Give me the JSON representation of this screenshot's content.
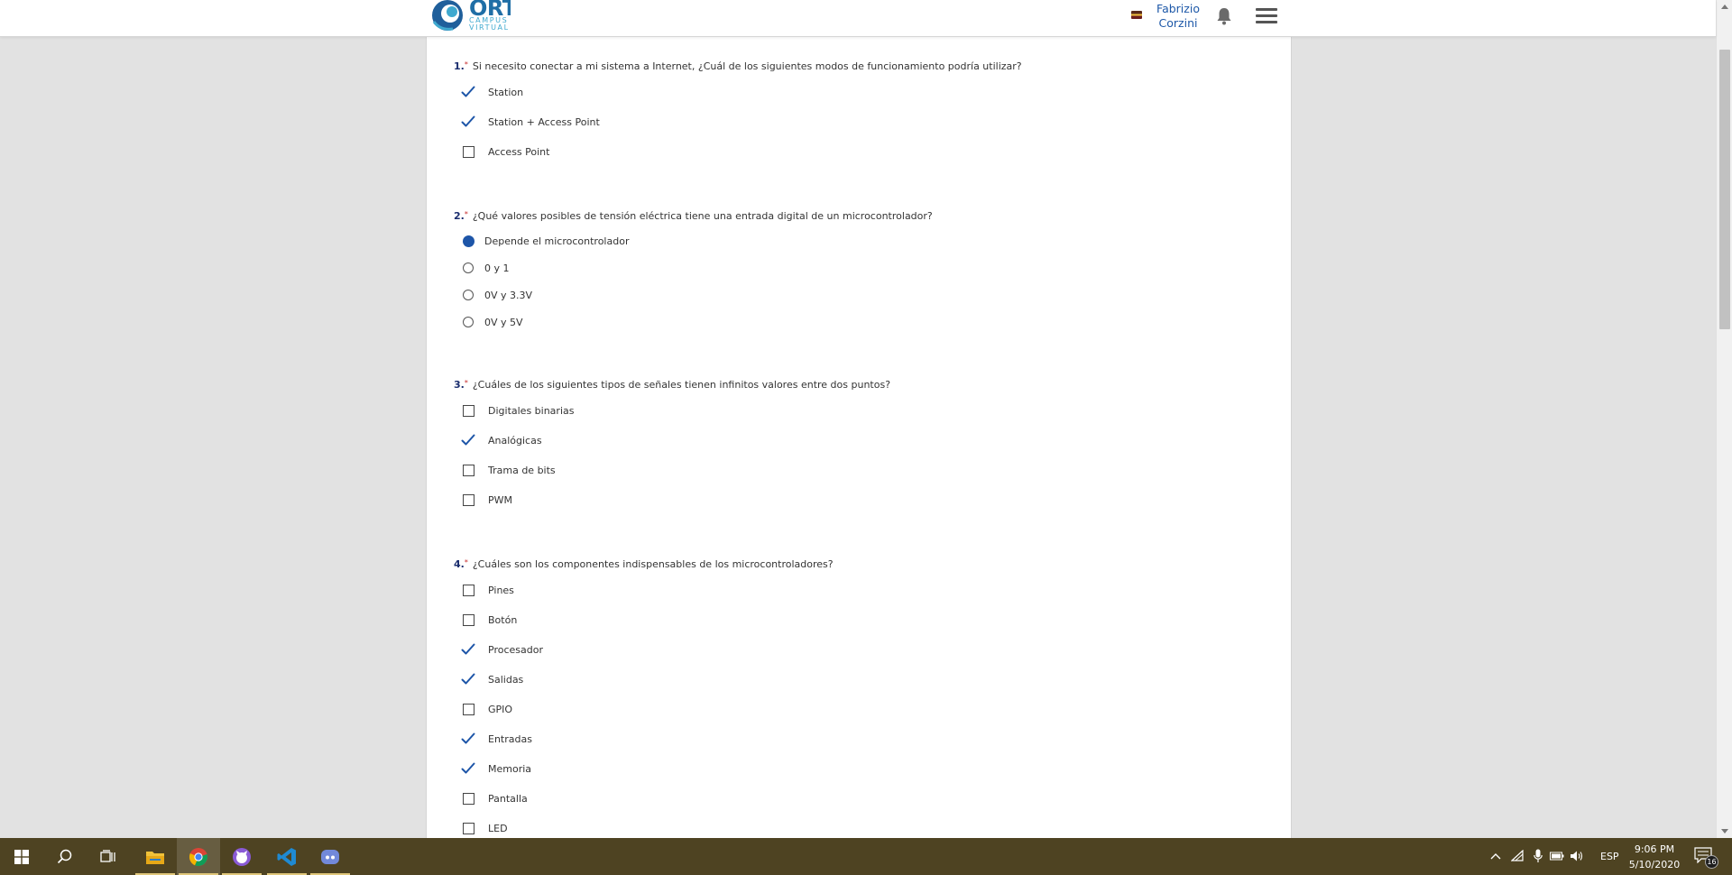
{
  "header": {
    "logo_text": "ORT",
    "logo_sub1": "CAMPUS",
    "logo_sub2": "VIRTUAL",
    "user_first": "Fabrizio",
    "user_last": "Corzini",
    "flag_icon": "flag-icon",
    "bell_icon": "bell-icon",
    "menu_icon": "hamburger-menu-icon"
  },
  "questions": [
    {
      "number": "1.",
      "required": "*",
      "text": "Si necesito conectar a mi sistema a Internet, ¿Cuál de los siguientes modos de funcionamiento podría utilizar?",
      "type": "checkbox",
      "options": [
        {
          "label": "Station",
          "checked": true
        },
        {
          "label": "Station + Access Point",
          "checked": true
        },
        {
          "label": "Access Point",
          "checked": false
        }
      ]
    },
    {
      "number": "2.",
      "required": "*",
      "text": "¿Qué valores posibles de tensión eléctrica tiene una entrada digital de un microcontrolador?",
      "type": "radio",
      "options": [
        {
          "label": "Depende el microcontrolador",
          "checked": true
        },
        {
          "label": "0 y 1",
          "checked": false
        },
        {
          "label": "0V y 3.3V",
          "checked": false
        },
        {
          "label": "0V y 5V",
          "checked": false
        }
      ]
    },
    {
      "number": "3.",
      "required": "*",
      "text": "¿Cuáles de los siguientes tipos de señales tienen infinitos valores entre dos puntos?",
      "type": "checkbox",
      "options": [
        {
          "label": "Digitales binarias",
          "checked": false
        },
        {
          "label": "Analógicas",
          "checked": true
        },
        {
          "label": "Trama de bits",
          "checked": false
        },
        {
          "label": "PWM",
          "checked": false
        }
      ]
    },
    {
      "number": "4.",
      "required": "*",
      "text": "¿Cuáles son los componentes indispensables de los microcontroladores?",
      "type": "checkbox",
      "options": [
        {
          "label": "Pines",
          "checked": false
        },
        {
          "label": "Botón",
          "checked": false
        },
        {
          "label": "Procesador",
          "checked": true
        },
        {
          "label": "Salidas",
          "checked": true
        },
        {
          "label": "GPIO",
          "checked": false
        },
        {
          "label": "Entradas",
          "checked": true
        },
        {
          "label": "Memoria",
          "checked": true
        },
        {
          "label": "Pantalla",
          "checked": false
        },
        {
          "label": "LED",
          "checked": false
        }
      ]
    }
  ],
  "colors": {
    "accent": "#1d55a8",
    "required": "#c62828",
    "taskbar": "#4e4322"
  },
  "taskbar": {
    "apps": [
      "windows-start-icon",
      "search-icon",
      "task-view-icon",
      "file-explorer-icon",
      "chrome-icon",
      "app-cat-icon",
      "vscode-icon",
      "discord-icon"
    ],
    "language": "ESP",
    "time": "9:06 PM",
    "date": "5/10/2020",
    "notification_count": "16"
  }
}
